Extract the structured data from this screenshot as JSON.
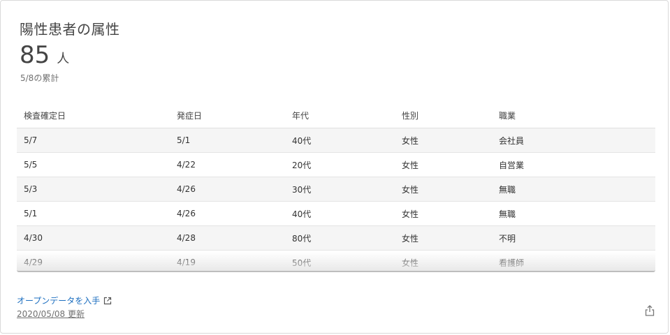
{
  "card": {
    "title": "陽性患者の属性",
    "count": "85",
    "unit": "人",
    "subnote": "5/8の累計"
  },
  "table": {
    "headers": [
      "検査確定日",
      "発症日",
      "年代",
      "性別",
      "職業"
    ],
    "rows": [
      [
        "5/7",
        "5/1",
        "40代",
        "女性",
        "会社員"
      ],
      [
        "5/5",
        "4/22",
        "20代",
        "女性",
        "自営業"
      ],
      [
        "5/3",
        "4/26",
        "30代",
        "女性",
        "無職"
      ],
      [
        "5/1",
        "4/26",
        "40代",
        "女性",
        "無職"
      ],
      [
        "4/30",
        "4/28",
        "80代",
        "女性",
        "不明"
      ],
      [
        "4/29",
        "4/19",
        "50代",
        "女性",
        "看護師"
      ]
    ]
  },
  "footer": {
    "opendata_label": "オープンデータを入手",
    "updated_label": "2020/05/08 更新",
    "opendata_icon": "external-link-icon",
    "share_icon": "share-icon"
  },
  "colors": {
    "link": "#1d6fc0",
    "row_stripe": "#f5f5f5"
  }
}
